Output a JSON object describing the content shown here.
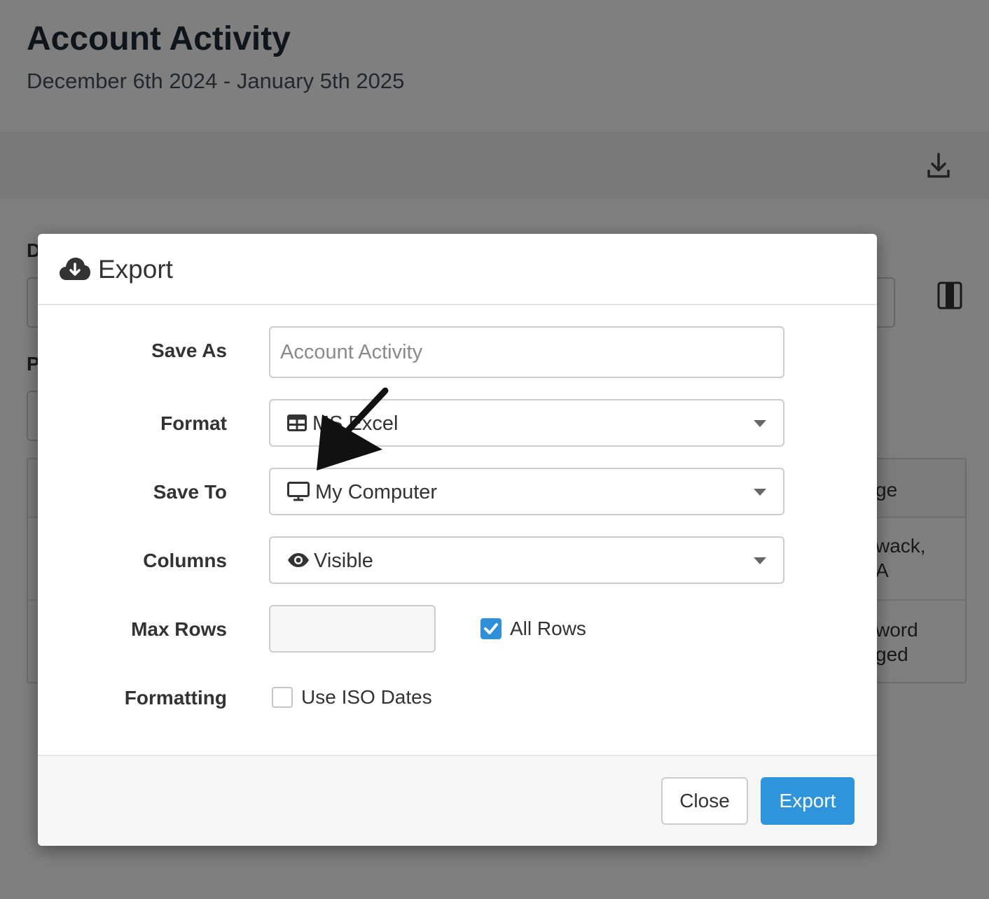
{
  "page": {
    "title": "Account Activity",
    "subtitle": "December 6th 2024 - January 5th 2025"
  },
  "background": {
    "label_d": "D",
    "label_p": "P",
    "table_cells": {
      "header": "ge",
      "row1_line1": "wack,",
      "row1_line2": "A",
      "row2_line1": "word",
      "row2_line2": "ged"
    }
  },
  "modal": {
    "title": "Export",
    "fields": {
      "save_as": {
        "label": "Save As",
        "placeholder": "Account Activity"
      },
      "format": {
        "label": "Format",
        "value": "MS Excel",
        "icon": "table-icon"
      },
      "save_to": {
        "label": "Save To",
        "value": "My Computer",
        "icon": "desktop-icon"
      },
      "columns": {
        "label": "Columns",
        "value": "Visible",
        "icon": "eye-icon"
      },
      "max_rows": {
        "label": "Max Rows",
        "value": "",
        "all_rows_label": "All Rows",
        "all_rows_checked": true
      },
      "formatting": {
        "label": "Formatting",
        "iso_label": "Use ISO Dates",
        "iso_checked": false
      }
    },
    "buttons": {
      "close": "Close",
      "export": "Export"
    }
  },
  "colors": {
    "primary": "#2e95dc",
    "overlay": "rgba(0,0,0,0.5)"
  }
}
